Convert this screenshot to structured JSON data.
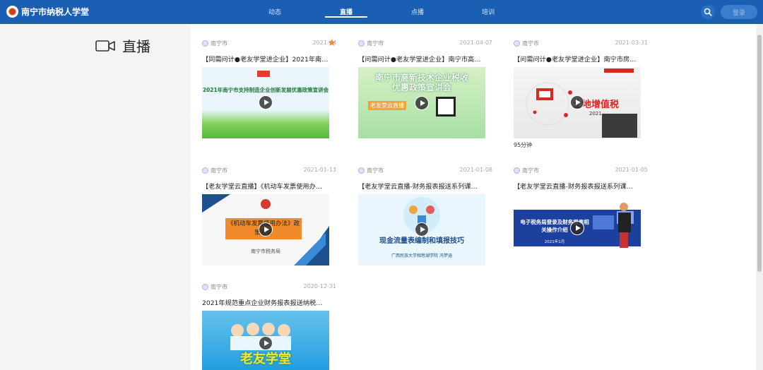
{
  "header": {
    "site_title": "南宁市纳税人学堂",
    "nav": [
      {
        "label": "动态",
        "active": false
      },
      {
        "label": "直播",
        "active": true
      },
      {
        "label": "点播",
        "active": false
      },
      {
        "label": "培训",
        "active": false
      }
    ],
    "login_label": "登录",
    "brand_color": "#1a5fb4"
  },
  "page": {
    "title": "直播"
  },
  "cards": [
    {
      "org": "南宁市",
      "date": "2021-04",
      "title": "【同需问计●老友学堂进企业】2021年南…",
      "thumb_text": "2021年南宁市支持制造企业创新发展优惠政策宣讲会",
      "starred": true
    },
    {
      "org": "南宁市",
      "date": "2021-04-07",
      "title": "【问需问计●老友学堂进企业】南宁市高…",
      "thumb_text": "南宁市高新技术企业税收优惠政策宣讲会",
      "thumb_sub": "老友堂云直播"
    },
    {
      "org": "南宁市",
      "date": "2021-03-31",
      "title": "【问需问计●老友学堂进企业】南宁市房…",
      "thumb_text": "土地增值税",
      "thumb_sub": "2021",
      "duration": "95分钟"
    },
    {
      "org": "南宁市",
      "date": "2021-01-13",
      "title": "【老友学堂云直播】《机动车发票使用办…",
      "thumb_text": "《机动车发票使用办法》政策宣讲",
      "thumb_sub": "南宁市税务局"
    },
    {
      "org": "南宁市",
      "date": "2021-01-08",
      "title": "【老友学堂云直播-财务报表报送系列课…",
      "thumb_text": "现金流量表编制和填报技巧",
      "thumb_sub": "广西民族大学相思湖学院 冯梦涵"
    },
    {
      "org": "南宁市",
      "date": "2021-01-05",
      "title": "【老友学堂云直播-财务报表报送系列课…",
      "thumb_text": "电子税务局登录及财务报表相关操作介绍",
      "thumb_sub": "2021年1月"
    },
    {
      "org": "南宁市",
      "date": "2020-12-31",
      "title": "2021年规范重点企业财务报表报送纳税…",
      "thumb_text": "老友学堂"
    }
  ]
}
